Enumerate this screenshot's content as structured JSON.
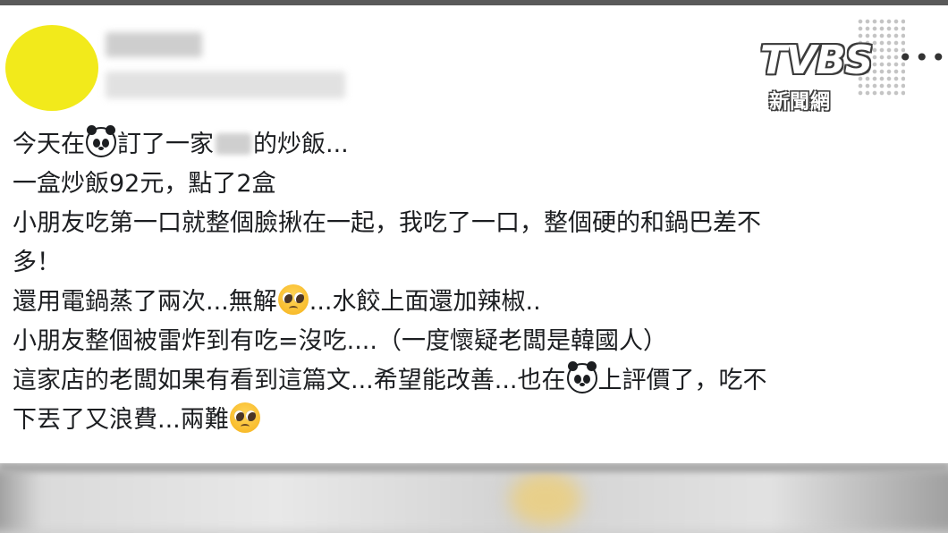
{
  "watermark": {
    "brand": "TVBS",
    "subtitle": "新聞網"
  },
  "post": {
    "more_icon": "ellipsis-icon",
    "lines": [
      {
        "segments": [
          "今天在",
          "訂了一家",
          "的炒飯..."
        ]
      },
      {
        "text": "一盒炒飯92元，點了2盒"
      },
      {
        "text": "小朋友吃第一口就整個臉揪在一起，我吃了一口，整個硬的和鍋巴差不"
      },
      {
        "text": "多！"
      },
      {
        "segments": [
          "還用電鍋蒸了兩次...無解",
          "...水餃上面還加辣椒.."
        ]
      },
      {
        "text": "小朋友整個被雷炸到有吃=沒吃....（一度懷疑老闆是韓國人）"
      },
      {
        "segments": [
          "這家店的老闆如果有看到這篇文...希望能改善...也在",
          "上評價了，吃不"
        ]
      },
      {
        "segments": [
          "下丟了又浪費...兩難"
        ]
      }
    ],
    "emojis": {
      "panda": "panda-face-emoji",
      "pleading": "pleading-face-emoji"
    }
  }
}
